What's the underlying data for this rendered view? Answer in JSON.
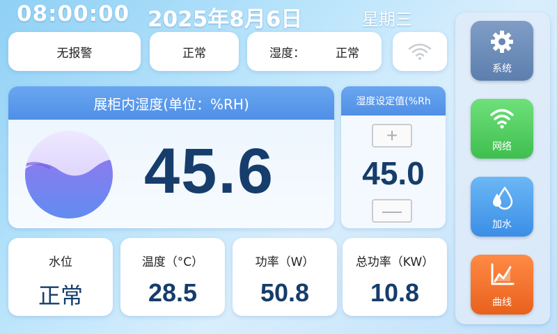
{
  "header": {
    "time": "08:00:00",
    "date": "2025年8月6日",
    "weekday": "星期三"
  },
  "status": {
    "alarm": "无报警",
    "state": "正常",
    "humidity_label": "湿度：",
    "humidity_state": "正常",
    "wifi_icon": "wifi-icon"
  },
  "main": {
    "title": "展柜内湿度(单位：%RH)",
    "humidity_value": "45.6"
  },
  "setpoint": {
    "title": "湿度设定值(%Rh",
    "value": "45.0",
    "plus": "+",
    "minus": "—"
  },
  "cards": [
    {
      "label": "水位",
      "value": "正常"
    },
    {
      "label": "温度（°C）",
      "value": "28.5"
    },
    {
      "label": "功率（W）",
      "value": "50.8"
    },
    {
      "label": "总功率（KW）",
      "value": "10.8"
    }
  ],
  "nav": [
    {
      "label": "系统",
      "icon": "gear-icon",
      "color": "#6886b5"
    },
    {
      "label": "网络",
      "icon": "wifi-icon",
      "color": "#4ccb5b"
    },
    {
      "label": "加水",
      "icon": "water-drop-icon",
      "color": "#4b9bea"
    },
    {
      "label": "曲线",
      "icon": "chart-icon",
      "color": "#f06f28"
    }
  ]
}
